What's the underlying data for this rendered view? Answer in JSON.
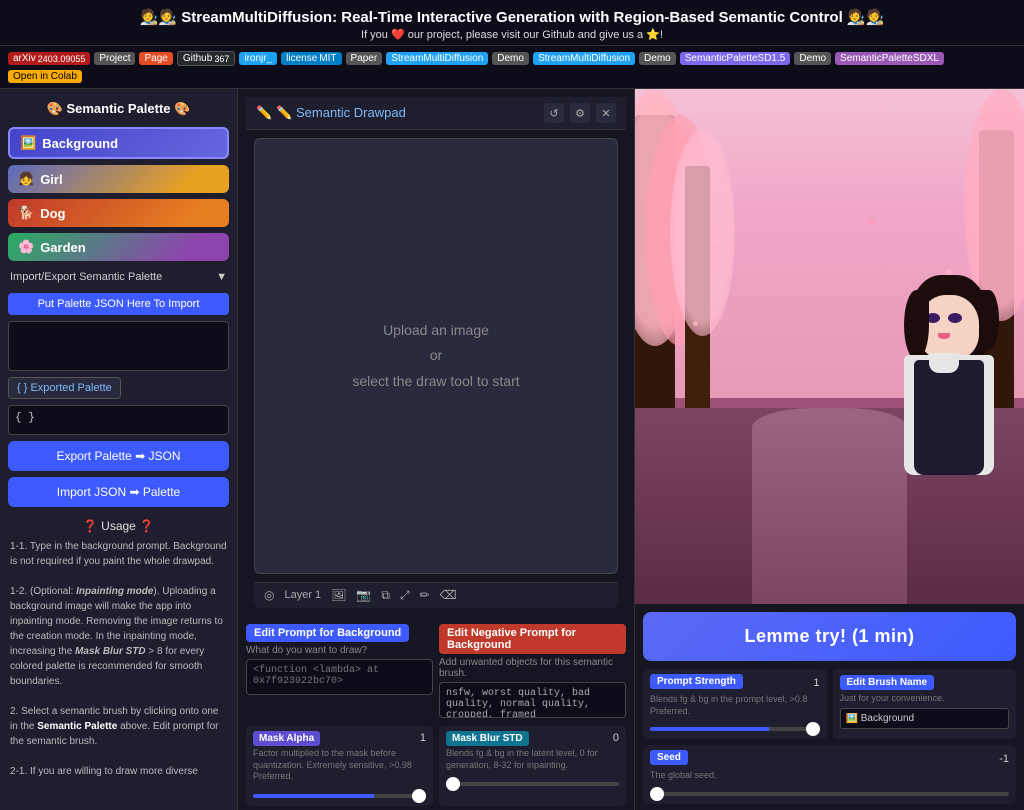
{
  "header": {
    "title": "🧑‍🎨🧑‍🎨 StreamMultiDiffusion: Real-Time Interactive Generation with Region-Based Semantic Control 🧑‍🎨🧑‍🎨",
    "subtitle": "If you ❤️ our project, please visit our Github and give us a ⭐!",
    "heart": "❤️",
    "star": "⭐"
  },
  "navbar": {
    "arxiv_label": "arXiv",
    "arxiv_id": "2403.09055",
    "project_label": "Project",
    "page_label": "Page",
    "github_label": "Github",
    "github_num": "367",
    "twitter_label": "ironjr_",
    "license_label": "license",
    "license_type": "MIT",
    "paper_label": "Paper",
    "demo1_label": "StreamMultiDiffusion",
    "demo_label": "Demo",
    "demo2_label": "StreamMultiDiffusion",
    "demo3_label": "SemanticPaletteSD1.5",
    "demo4_label": "SemanticPaletteSDXL",
    "colab_label": "Open in Colab"
  },
  "sidebar": {
    "title": "🎨 Semantic Palette 🎨",
    "palette_items": [
      {
        "emoji": "🖼️",
        "label": "Background",
        "style": "background"
      },
      {
        "emoji": "👧",
        "label": "Girl",
        "style": "girl"
      },
      {
        "emoji": "🐕",
        "label": "Dog",
        "style": "dog"
      },
      {
        "emoji": "🌸",
        "label": "Garden",
        "style": "garden"
      }
    ],
    "import_export_label": "Import/Export Semantic Palette",
    "import_btn": "Put Palette JSON Here To Import",
    "json_placeholder": "",
    "exported_btn": "{ } Exported Palette",
    "json_display": "{ }",
    "export_btn": "Export Palette ➡ JSON",
    "import_json_btn": "Import JSON ➡ Palette"
  },
  "usage": {
    "title": "❓ Usage ❓",
    "text_1": "1-1. Type in the background prompt. Background is not required if you paint the whole drawpad.",
    "text_2": "1-2. (Optional: Inpainting mode). Uploading a background image will make the app into inpainting mode. Removing the image returns to the creation mode. In the inpainting mode, increasing the Mask Blur STD > 8 for every colored palette is recommended for smooth boundaries.",
    "text_3": "2. Select a semantic brush by clicking onto one in the Semantic Palette above. Edit prompt for the semantic brush.",
    "text_4": "2-1. If you are willing to draw more diverse"
  },
  "drawpad": {
    "title": "✏️ Semantic Drawpad",
    "placeholder_line1": "Upload an image",
    "placeholder_line2": "or",
    "placeholder_line3": "select the draw tool to start",
    "layer_label": "Layer 1"
  },
  "bottom_left": {
    "edit_prompt_label": "Edit Prompt for Background",
    "prompt_sub": "What do you want to draw?",
    "prompt_placeholder": "<function <lambda> at 0x7f923922bc70>",
    "neg_prompt_label": "Edit Negative Prompt for Background",
    "neg_prompt_sub": "Add unwanted objects for this semantic brush.",
    "neg_prompt_value": "nsfw, worst quality, bad quality, normal quality, cropped, framed",
    "mask_alpha_label": "Mask Alpha",
    "mask_alpha_value": "1",
    "mask_alpha_desc": "Factor multiplied to the mask before quantization. Extremely sensitive, >0.98 Preferred.",
    "mask_blur_label": "Mask Blur STD",
    "mask_blur_value": "0",
    "mask_blur_desc": "Blends fg & bg in the latent level, 0 for generation, 8-32 for inpainting."
  },
  "right_panel": {
    "try_btn": "Lemme try! (1 min)",
    "prompt_strength_label": "Prompt Strength",
    "prompt_strength_value": "1",
    "prompt_strength_desc": "Blends fg & bg in the prompt level, >0.8 Preferred.",
    "brush_name_label": "Edit Brush Name",
    "brush_name_desc": "Just for your convenience.",
    "brush_name_value": "🖼️ Background",
    "seed_label": "Seed",
    "seed_value": "-1",
    "seed_desc": "The global seed."
  }
}
